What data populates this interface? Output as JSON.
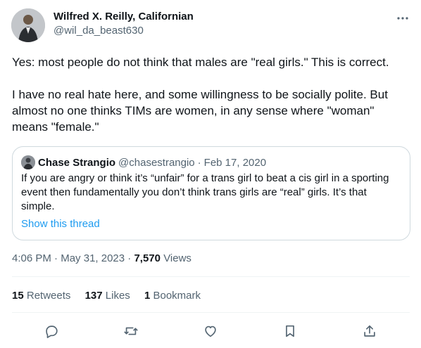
{
  "author": {
    "name": "Wilfred X. Reilly, Californian",
    "handle": "@wil_da_beast630"
  },
  "tweet": {
    "paragraph1_line1": "Yes: most people do not think that males are \"real girls.\" This is correct.",
    "paragraph2_line1": "I have no real hate here, and some willingness to be socially polite. But",
    "paragraph2_line2": "almost no one thinks TIMs are women, in any sense where \"woman\"",
    "paragraph2_line3": "means \"female.\""
  },
  "quote": {
    "name": "Chase Strangio",
    "handle": "@chasestrangio",
    "separator": "·",
    "date": "Feb 17, 2020",
    "line1": "If you are angry or think it’s “unfair” for a trans girl to beat a cis girl in a sporting",
    "line2": "event then fundamentally you don’t think trans girls are “real” girls. It’s that",
    "line3": "simple.",
    "show_thread": "Show this thread"
  },
  "meta": {
    "time": "4:06 PM",
    "sep1": "·",
    "date": "May 31, 2023",
    "sep2": "·",
    "views_count": "7,570",
    "views_label": "Views"
  },
  "stats": {
    "retweets_count": "15",
    "retweets_label": "Retweets",
    "likes_count": "137",
    "likes_label": "Likes",
    "bookmarks_count": "1",
    "bookmarks_label": "Bookmark"
  },
  "icons": {
    "more": "more-horizontal-icon",
    "reply": "reply-icon",
    "retweet": "retweet-icon",
    "like": "like-icon",
    "bookmark": "bookmark-icon",
    "share": "share-icon"
  },
  "colors": {
    "text": "#0f1419",
    "secondary": "#536471",
    "accent": "#1d9bf0",
    "border": "#cfd9de"
  }
}
